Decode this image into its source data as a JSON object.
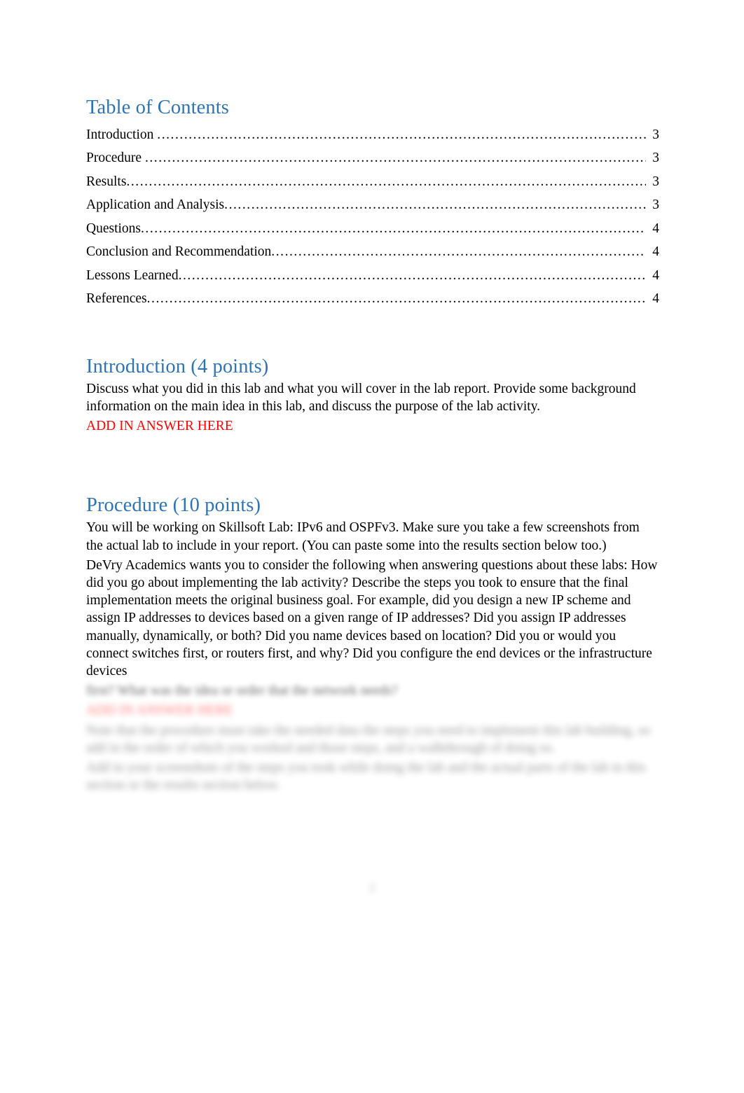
{
  "document": {
    "page_number_footer": "2"
  },
  "toc": {
    "title": "Table of Contents",
    "entries": [
      {
        "label": "Introduction",
        "space_before_dots": true,
        "page": "3"
      },
      {
        "label": "Procedure",
        "space_before_dots": true,
        "page": "3"
      },
      {
        "label": "Results",
        "space_before_dots": false,
        "page": "3"
      },
      {
        "label": "Application and Analysis",
        "space_before_dots": false,
        "page": "3"
      },
      {
        "label": "Questions",
        "space_before_dots": false,
        "page": "4"
      },
      {
        "label": "Conclusion and Recommendation",
        "space_before_dots": false,
        "page": "4"
      },
      {
        "label": "Lessons Learned",
        "space_before_dots": false,
        "page": "4"
      },
      {
        "label": "References",
        "space_before_dots": false,
        "page": "4"
      }
    ],
    "dot_leader": "............................................................................................................................................................................................"
  },
  "introduction": {
    "heading": "Introduction (4 points)",
    "body": "Discuss what you did in this lab and what you will cover in the lab report.    Provide some background information on the main idea in this lab, and discuss the purpose of the lab activity.",
    "answer_placeholder": "ADD IN ANSWER HERE"
  },
  "procedure": {
    "heading": "Procedure (10 points)",
    "body": "You will be working on Skillsoft Lab: IPv6 and OSPFv3. Make sure you take a few screenshots from the actual lab to include in your report. (You can paste some into the results section below too.)",
    "devry_paragraph": "DeVry Academics wants you to consider the following when answering questions about these labs: How did you go about implementing the lab activity? Describe the steps you took to ensure that the final implementation meets the original business goal. For example, did you design a new IP scheme and assign IP addresses to devices based on a given range of IP addresses? Did you assign IP addresses manually, dynamically, or both? Did you name devices based on location? Did you or would you connect switches first, or routers first, and why? Did you configure the end devices or the infrastructure devices",
    "obscured_line": "first? What was the idea or order that the network needs?",
    "obscured_answer_placeholder": "ADD IN ANSWER HERE",
    "obscured_paragraph_1": "Note that the procedure must take the needed data the steps you need to implement this lab building, so add in the order of which you worked and those steps, and a walkthrough of doing so.",
    "obscured_paragraph_2": "Add in your screenshots of the steps you took while doing the lab and the actual parts of the lab in this section or the results section below."
  }
}
